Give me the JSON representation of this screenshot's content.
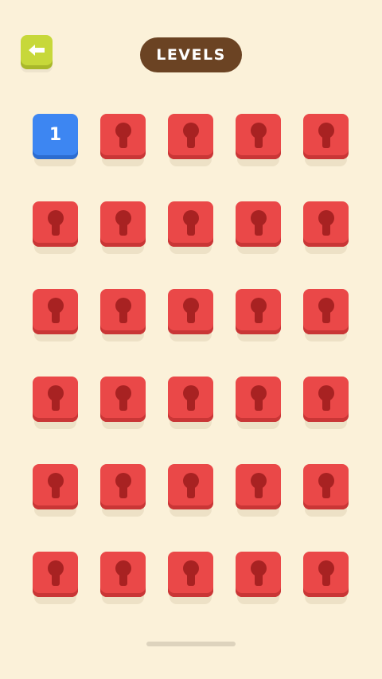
{
  "header": {
    "title": "LEVELS",
    "back_icon": "arrow-left-icon"
  },
  "levels": {
    "unlocked": [
      {
        "number": "1"
      }
    ],
    "locked_count": 29,
    "lock_icon": "keyhole-lock-icon"
  },
  "colors": {
    "background": "#fbf1d9",
    "back_button": "#c7d83a",
    "title_pill": "#6b4323",
    "unlocked_tile": "#3d86f2",
    "locked_tile": "#ea4848",
    "keyhole": "#a82222"
  }
}
